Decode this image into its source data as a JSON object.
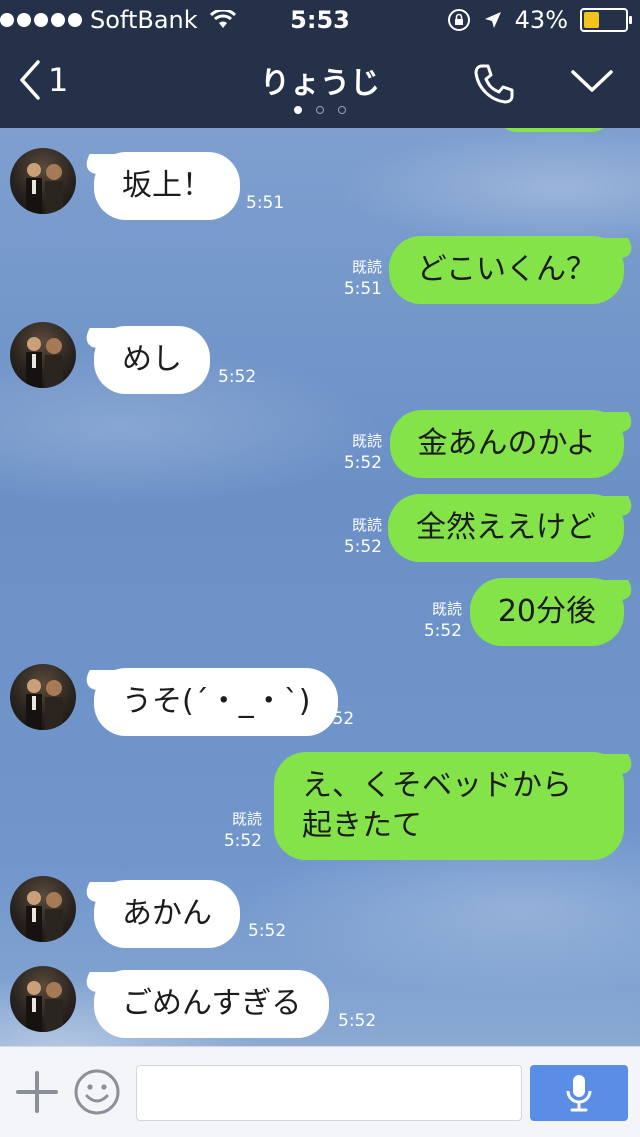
{
  "status": {
    "carrier": "SoftBank",
    "time": "5:53",
    "battery_text": "43%",
    "battery_level": 0.43
  },
  "header": {
    "back_count": "1",
    "title": "りょうじ",
    "pager": {
      "count": 3,
      "active": 0
    }
  },
  "messages": [
    {
      "dir": "in",
      "text": "坂上！",
      "time": "5:51"
    },
    {
      "dir": "out",
      "text": "どこいくん？",
      "time": "5:51",
      "read": "既読"
    },
    {
      "dir": "in",
      "text": "めし",
      "time": "5:52"
    },
    {
      "dir": "out",
      "text": "金あんのかよ",
      "time": "5:52",
      "read": "既読"
    },
    {
      "dir": "out",
      "text": "全然ええけど",
      "time": "5:52",
      "read": "既読"
    },
    {
      "dir": "out",
      "text": "20分後",
      "time": "5:52",
      "read": "既読"
    },
    {
      "dir": "in",
      "text": "うそ(´・_・`)",
      "time": "5:52"
    },
    {
      "dir": "out",
      "text": "え、くそベッドから起きたて",
      "time": "5:52",
      "read": "既読"
    },
    {
      "dir": "in",
      "text": "あかん",
      "time": "5:52"
    },
    {
      "dir": "in",
      "text": "ごめんすぎる",
      "time": "5:52"
    }
  ],
  "input": {
    "value": "",
    "placeholder": ""
  },
  "colors": {
    "nav_bg": "#253149",
    "outgoing_bubble": "#84e349",
    "incoming_bubble": "#ffffff",
    "send_button": "#5a8ee6",
    "battery": "#f2c31b"
  },
  "icons": [
    "back-chevron-icon",
    "phone-icon",
    "chevron-down-icon",
    "plus-icon",
    "smiley-icon",
    "microphone-icon",
    "wifi-icon",
    "orientation-lock-icon",
    "location-arrow-icon",
    "battery-icon"
  ]
}
